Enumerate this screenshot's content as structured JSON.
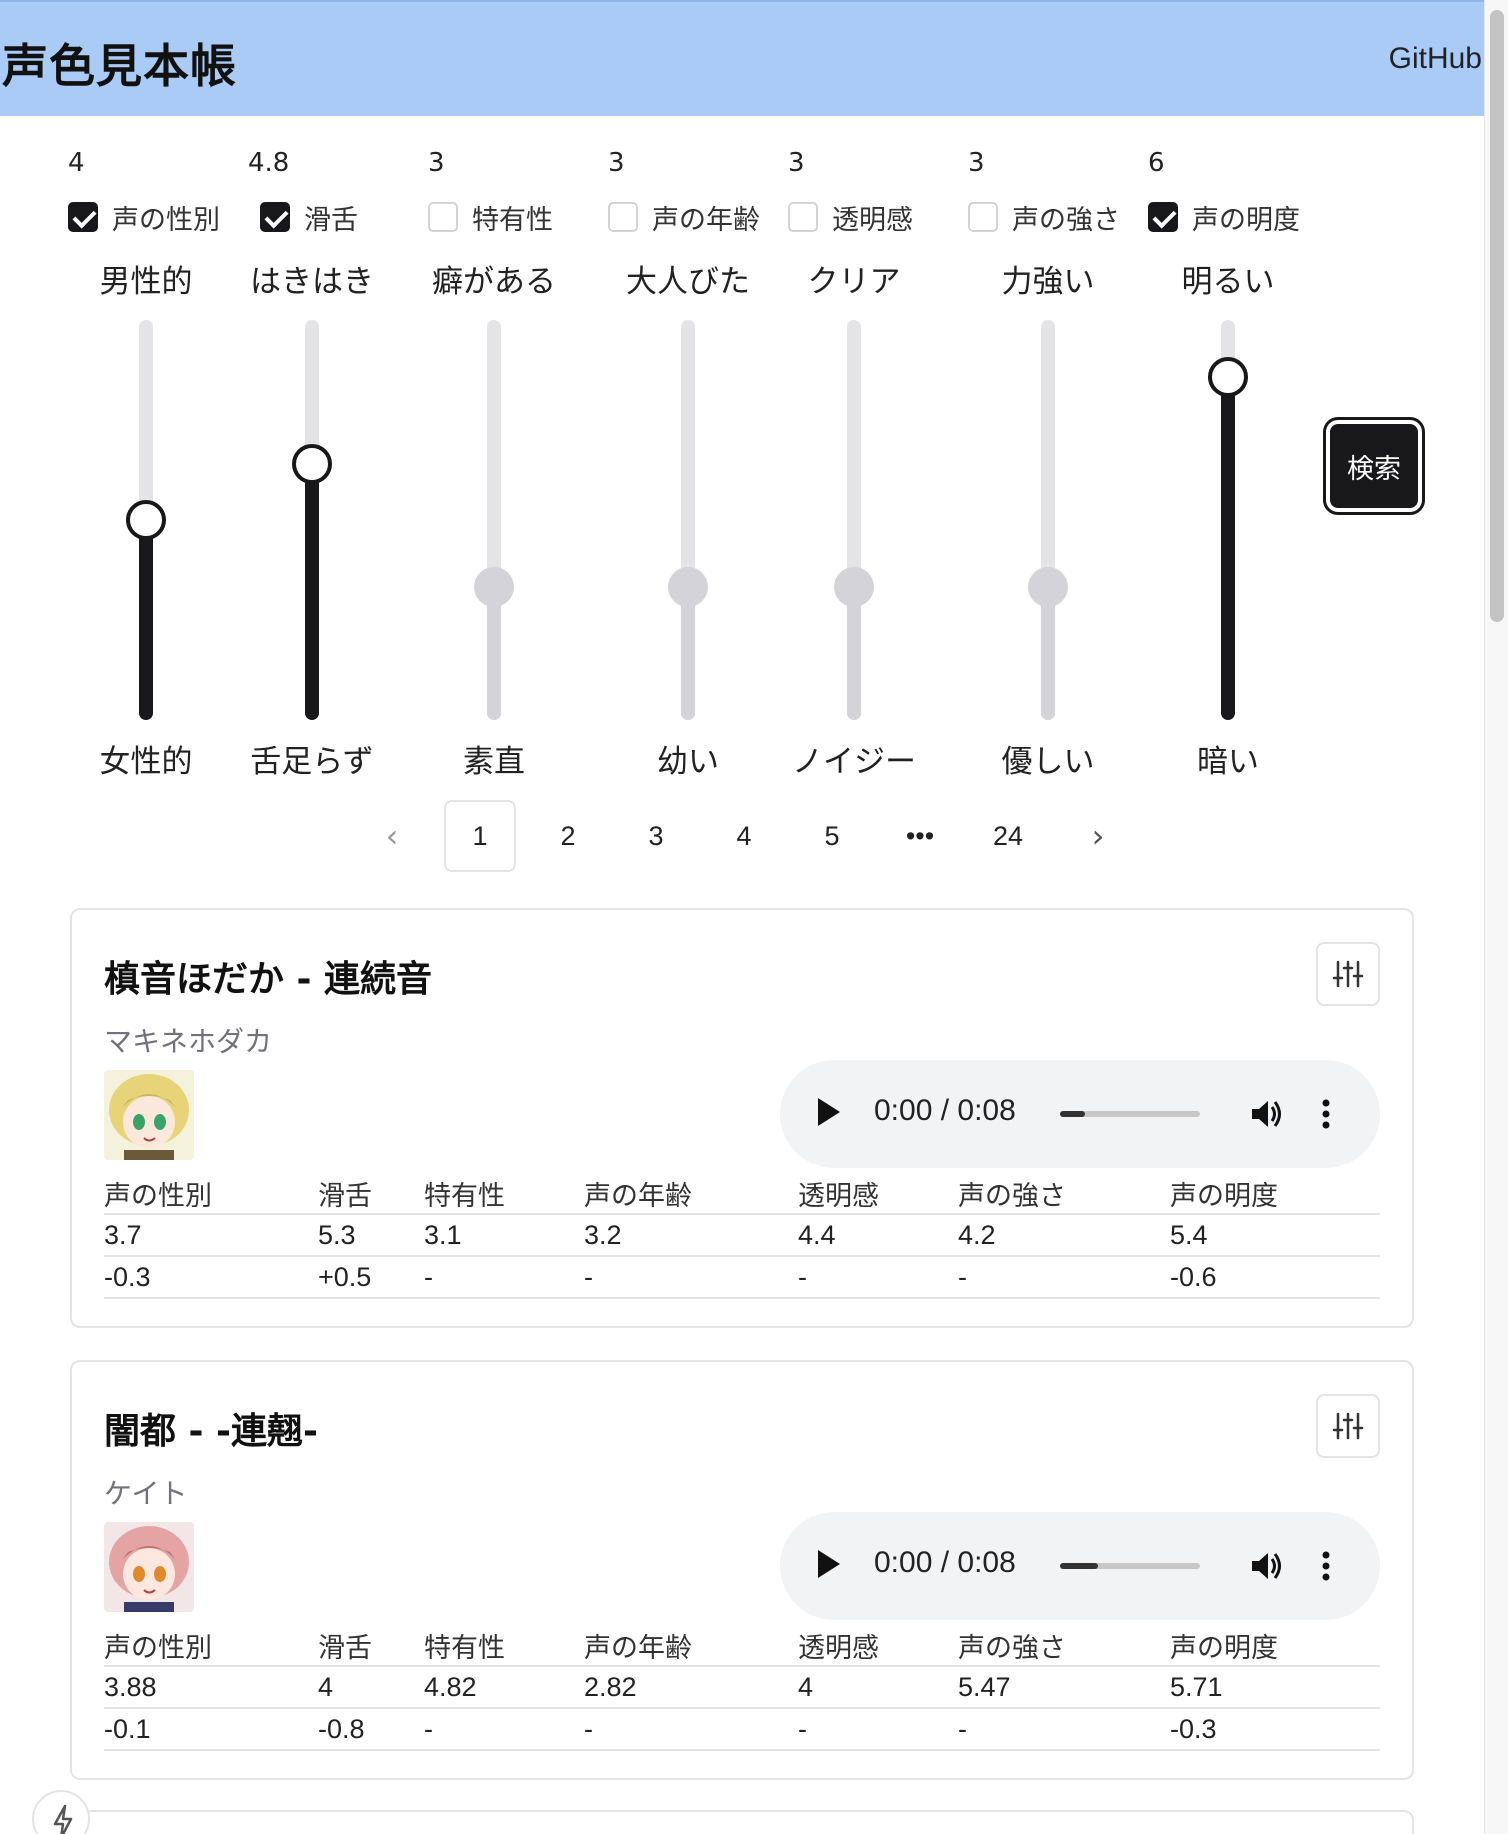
{
  "header": {
    "title": "声色見本帳",
    "github_label": "GitHub"
  },
  "sliders": [
    {
      "key": "gender",
      "value": "4",
      "label": "声の性別",
      "checked": true,
      "top": "男性的",
      "bottom": "女性的",
      "level": 0.5
    },
    {
      "key": "fluency",
      "value": "4.8",
      "label": "滑舌",
      "checked": true,
      "top": "はきはき",
      "bottom": "舌足らず",
      "level": 0.64
    },
    {
      "key": "uniqueness",
      "value": "3",
      "label": "特有性",
      "checked": false,
      "top": "癖がある",
      "bottom": "素直",
      "level": 0.333
    },
    {
      "key": "age",
      "value": "3",
      "label": "声の年齢",
      "checked": false,
      "top": "大人びた",
      "bottom": "幼い",
      "level": 0.333
    },
    {
      "key": "clarity",
      "value": "3",
      "label": "透明感",
      "checked": false,
      "top": "クリア",
      "bottom": "ノイジー",
      "level": 0.333
    },
    {
      "key": "strength",
      "value": "3",
      "label": "声の強さ",
      "checked": false,
      "top": "力強い",
      "bottom": "優しい",
      "level": 0.333
    },
    {
      "key": "brightness",
      "value": "6",
      "label": "声の明度",
      "checked": true,
      "top": "明るい",
      "bottom": "暗い",
      "level": 0.857
    }
  ],
  "search_label": "検索",
  "pagination": {
    "prev": "‹",
    "pages": [
      "1",
      "2",
      "3",
      "4",
      "5"
    ],
    "ellipsis": "•••",
    "last": "24",
    "next": "›",
    "current": "1"
  },
  "stat_headers": [
    "声の性別",
    "滑舌",
    "特有性",
    "声の年齢",
    "透明感",
    "声の強さ",
    "声の明度"
  ],
  "cards": [
    {
      "title": "槙音ほだか - 連続音",
      "kana": "マキネホダカ",
      "audio_time": "0:00 / 0:08",
      "audio_progress": 0.18,
      "values": [
        "3.7",
        "5.3",
        "3.1",
        "3.2",
        "4.4",
        "4.2",
        "5.4"
      ],
      "diffs": [
        "-0.3",
        "+0.5",
        "-",
        "-",
        "-",
        "-",
        "-0.6"
      ]
    },
    {
      "title": "闇都 - -連翹-",
      "kana": "ケイト",
      "audio_time": "0:00 / 0:08",
      "audio_progress": 0.27,
      "values": [
        "3.88",
        "4",
        "4.82",
        "2.82",
        "4",
        "5.47",
        "5.71"
      ],
      "diffs": [
        "-0.1",
        "-0.8",
        "-",
        "-",
        "-",
        "-",
        "-0.3"
      ]
    }
  ],
  "colors": {
    "header_bg": "#a9cbf5",
    "accent": "#18181b",
    "disabled": "#d4d4d8",
    "audio_bg": "#f1f3f4"
  },
  "icons": {
    "tune": "sliders-icon",
    "play": "play-icon",
    "volume": "volume-icon",
    "more": "more-vert-icon",
    "bolt": "bolt-icon"
  }
}
